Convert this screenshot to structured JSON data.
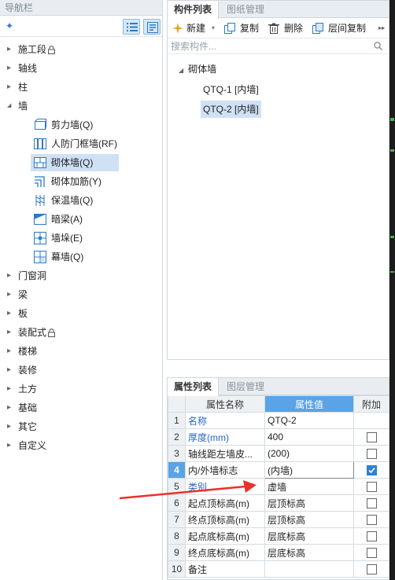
{
  "nav": {
    "title": "导航栏",
    "tree": [
      {
        "label": "施工段",
        "locked": true,
        "expanded": false
      },
      {
        "label": "轴线",
        "expanded": false
      },
      {
        "label": "柱",
        "expanded": false
      },
      {
        "label": "墙",
        "expanded": true,
        "children": [
          {
            "label": "剪力墙(Q)",
            "icon": "shear-wall-icon"
          },
          {
            "label": "人防门框墙(RF)",
            "icon": "civil-defense-wall-icon"
          },
          {
            "label": "砌体墙(Q)",
            "icon": "masonry-wall-icon",
            "selected": true
          },
          {
            "label": "砌体加筋(Y)",
            "icon": "masonry-rebar-icon"
          },
          {
            "label": "保温墙(Q)",
            "icon": "insulation-wall-icon"
          },
          {
            "label": "暗梁(A)",
            "icon": "hidden-beam-icon"
          },
          {
            "label": "墙垛(E)",
            "icon": "wall-pier-icon"
          },
          {
            "label": "幕墙(Q)",
            "icon": "curtain-wall-icon"
          }
        ]
      },
      {
        "label": "门窗洞",
        "expanded": false
      },
      {
        "label": "梁",
        "expanded": false
      },
      {
        "label": "板",
        "expanded": false
      },
      {
        "label": "装配式",
        "locked": true,
        "expanded": false
      },
      {
        "label": "楼梯",
        "expanded": false
      },
      {
        "label": "装修",
        "expanded": false
      },
      {
        "label": "土方",
        "expanded": false
      },
      {
        "label": "基础",
        "expanded": false
      },
      {
        "label": "其它",
        "expanded": false
      },
      {
        "label": "自定义",
        "expanded": false
      }
    ]
  },
  "components": {
    "tabs": [
      "构件列表",
      "图纸管理"
    ],
    "toolbar": {
      "new": "新建",
      "copy": "复制",
      "delete": "删除",
      "floor_copy": "层间复制"
    },
    "search_placeholder": "搜索构件...",
    "group": "砌体墙",
    "items": [
      {
        "label": "QTQ-1 [内墙]",
        "selected": false
      },
      {
        "label": "QTQ-2 [内墙]",
        "selected": true
      }
    ]
  },
  "properties": {
    "tabs": [
      "属性列表",
      "图层管理"
    ],
    "headers": {
      "name": "属性名称",
      "value": "属性值",
      "extra": "附加"
    },
    "rows": [
      {
        "no": "1",
        "name": "名称",
        "value": "QTQ-2",
        "blue": true,
        "checkbox": false,
        "checked": false
      },
      {
        "no": "2",
        "name": "厚度(mm)",
        "value": "400",
        "blue": true,
        "checkbox": true,
        "checked": false
      },
      {
        "no": "3",
        "name": "轴线距左墙皮...",
        "value": "(200)",
        "blue": false,
        "checkbox": true,
        "checked": false
      },
      {
        "no": "4",
        "name": "内/外墙标志",
        "value": "(内墙)",
        "blue": false,
        "checkbox": true,
        "checked": true,
        "current": true
      },
      {
        "no": "5",
        "name": "类别",
        "value": "虚墙",
        "blue": true,
        "checkbox": true,
        "checked": false
      },
      {
        "no": "6",
        "name": "起点顶标高(m)",
        "value": "层顶标高",
        "blue": false,
        "checkbox": true,
        "checked": false
      },
      {
        "no": "7",
        "name": "终点顶标高(m)",
        "value": "层顶标高",
        "blue": false,
        "checkbox": true,
        "checked": false
      },
      {
        "no": "8",
        "name": "起点底标高(m)",
        "value": "层底标高",
        "blue": false,
        "checkbox": true,
        "checked": false
      },
      {
        "no": "9",
        "name": "终点底标高(m)",
        "value": "层底标高",
        "blue": false,
        "checkbox": true,
        "checked": false
      },
      {
        "no": "10",
        "name": "备注",
        "value": "",
        "blue": false,
        "checkbox": true,
        "checked": false
      }
    ]
  },
  "colors": {
    "accent": "#5aa3e6",
    "selection": "#cfe1f5",
    "annotation_arrow": "#e8332a"
  }
}
